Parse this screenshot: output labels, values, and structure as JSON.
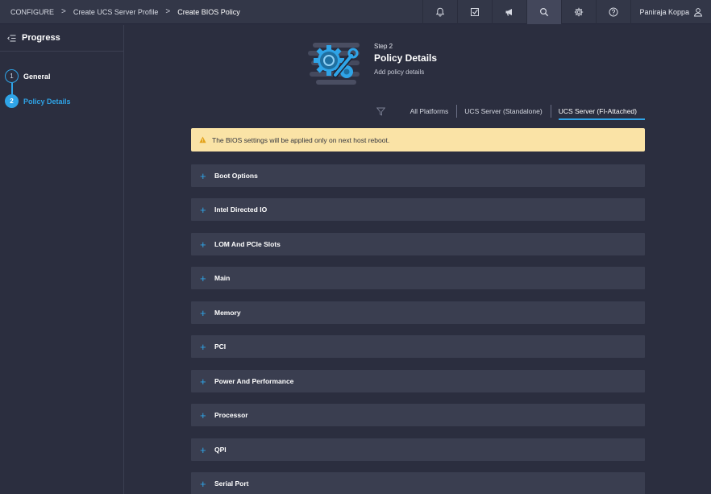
{
  "breadcrumb": {
    "items": [
      "CONFIGURE",
      "Create UCS Server Profile",
      "Create BIOS Policy"
    ],
    "separator": ">"
  },
  "topbar": {
    "icons": [
      "bell-icon",
      "tasks-check-icon",
      "megaphone-icon",
      "search-icon",
      "gear-icon",
      "help-icon"
    ],
    "user_name": "Paniraja Koppa"
  },
  "sidebar": {
    "title": "Progress",
    "steps": [
      {
        "number": "1",
        "label": "General"
      },
      {
        "number": "2",
        "label": "Policy Details"
      }
    ]
  },
  "header": {
    "step": "Step 2",
    "title": "Policy Details",
    "subtitle": "Add policy details"
  },
  "filters": {
    "options": [
      "All Platforms",
      "UCS Server (Standalone)",
      "UCS Server (FI-Attached)"
    ],
    "selected": "UCS Server (FI-Attached)"
  },
  "alert": {
    "text": "The BIOS settings will be applied only on next host reboot."
  },
  "sections": [
    "Boot Options",
    "Intel Directed IO",
    "LOM And PCIe Slots",
    "Main",
    "Memory",
    "PCI",
    "Power And Performance",
    "Processor",
    "QPI",
    "Serial Port"
  ],
  "colors": {
    "accent": "#2fa4e7",
    "background": "#2b2e3f",
    "panel": "#3a3e50",
    "alert_bg": "#fae3a6",
    "alert_icon": "#e3a21a"
  }
}
